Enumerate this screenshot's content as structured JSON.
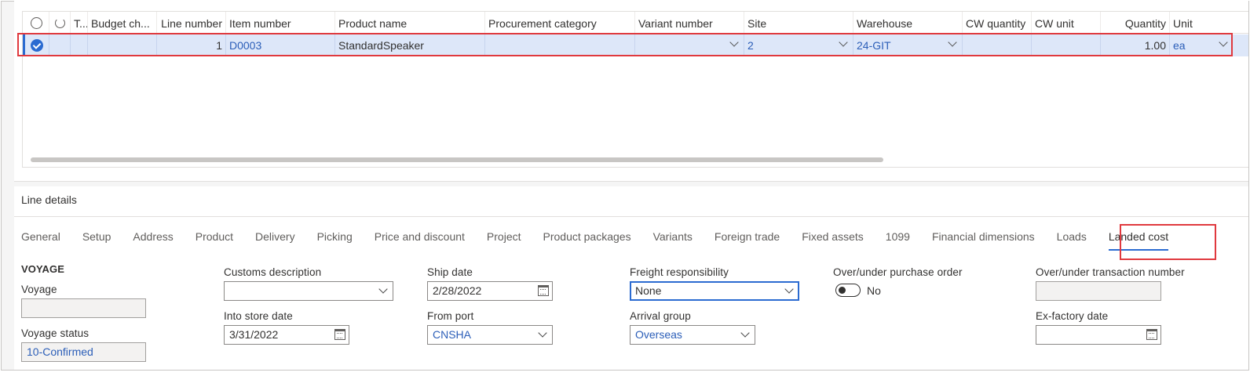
{
  "grid": {
    "columns": [
      "T...",
      "Budget ch...",
      "Line number",
      "Item number",
      "Product name",
      "Procurement category",
      "Variant number",
      "Site",
      "Warehouse",
      "CW quantity",
      "CW unit",
      "Quantity",
      "Unit"
    ],
    "row": {
      "line_number": "1",
      "item_number": "D0003",
      "product_name": "StandardSpeaker",
      "procurement_category": "",
      "variant_number": "",
      "site": "2",
      "warehouse": "24-GIT",
      "cw_quantity": "",
      "cw_unit": "",
      "quantity": "1.00",
      "unit": "ea"
    }
  },
  "details": {
    "title": "Line details",
    "tabs": [
      "General",
      "Setup",
      "Address",
      "Product",
      "Delivery",
      "Picking",
      "Price and discount",
      "Project",
      "Product packages",
      "Variants",
      "Foreign trade",
      "Fixed assets",
      "1099",
      "Financial dimensions",
      "Loads",
      "Landed cost"
    ],
    "active_tab": "Landed cost",
    "section_heading": "VOYAGE",
    "fields": {
      "voyage": {
        "label": "Voyage",
        "value": ""
      },
      "voyage_status": {
        "label": "Voyage status",
        "value": "10-Confirmed"
      },
      "customs_description": {
        "label": "Customs description",
        "value": ""
      },
      "into_store_date": {
        "label": "Into store date",
        "value": "3/31/2022"
      },
      "ship_date": {
        "label": "Ship date",
        "value": "2/28/2022"
      },
      "from_port": {
        "label": "From port",
        "value": "CNSHA"
      },
      "freight_responsibility": {
        "label": "Freight responsibility",
        "value": "None"
      },
      "arrival_group": {
        "label": "Arrival group",
        "value": "Overseas"
      },
      "over_under_po": {
        "label": "Over/under purchase order",
        "value": "No"
      },
      "over_under_txn": {
        "label": "Over/under transaction number",
        "value": ""
      },
      "ex_factory_date": {
        "label": "Ex-factory date",
        "value": ""
      }
    }
  },
  "colors": {
    "accent": "#2b6bd1",
    "highlight": "#e0393e",
    "selected_row": "#dde7f9",
    "link": "#2b5eb8"
  }
}
